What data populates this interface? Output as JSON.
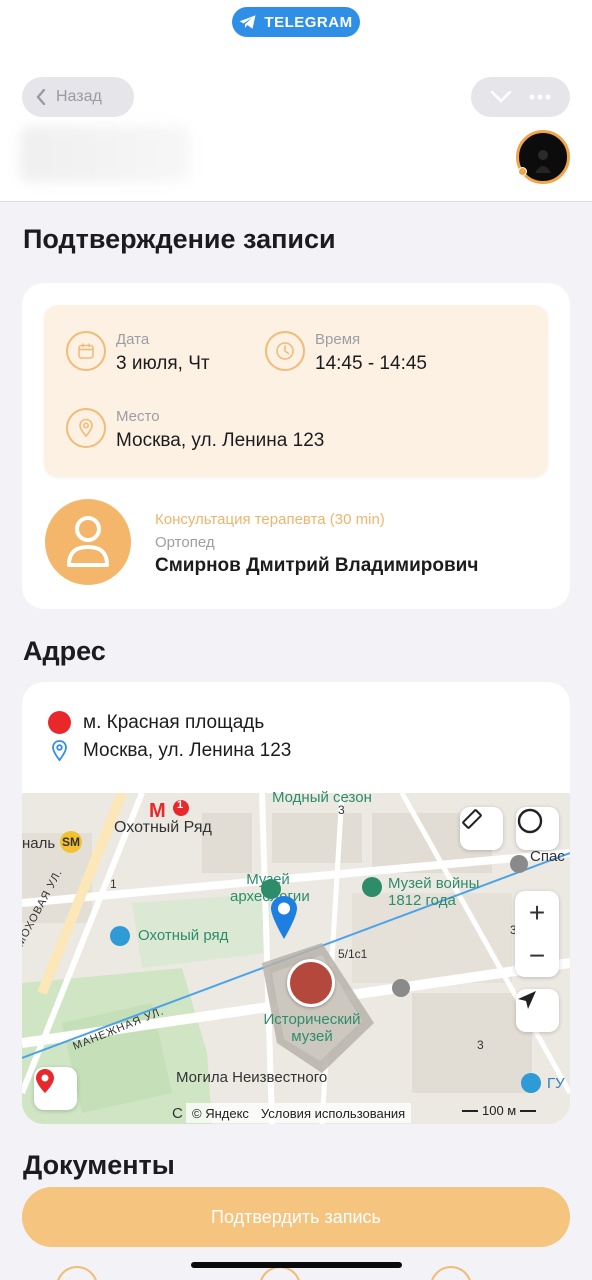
{
  "header": {
    "app_badge": "TELEGRAM",
    "back_label": "Назад"
  },
  "page_title": "Подтверждение записи",
  "appointment": {
    "date_label": "Дата",
    "date_value": "3 июля, Чт",
    "time_label": "Время",
    "time_value": "14:45 - 14:45",
    "place_label": "Место",
    "place_value": "Москва, ул. Ленина 123",
    "service": "Консультация терапевта (30 min)",
    "specialty": "Ортопед",
    "doctor": "Смирнов Дмитрий Владимирович"
  },
  "address": {
    "title": "Адрес",
    "metro": "м. Красная площадь",
    "street": "Москва, ул. Ленина 123"
  },
  "map": {
    "labels": {
      "modny_sezon": "Модный сезон",
      "okhotny_ryad_metro": "Охотный Ряд",
      "metro_line": "1",
      "museum_archaeology": "Музей археологии",
      "museum_1812": "Музей войны 1812 года",
      "okhotny_ryad_mall": "Охотный ряд",
      "historical_museum": "Исторический музей",
      "mokhovaya": "МОХОВАЯ УЛ.",
      "manezhnaya": "МАНЕЖНАЯ УЛ.",
      "tomb": "Могила Неизвестного",
      "tomb_tail": "С",
      "spas": "Спас",
      "gum": "ГУ",
      "kanal": "наль",
      "house_3a": "3",
      "house_1": "1",
      "house_5": "5/1с1",
      "house_3b": "3",
      "house_3c": "3"
    },
    "attribution": "© Яндекс",
    "terms": "Условия использования",
    "scale": "100 м"
  },
  "documents_title": "Документы",
  "confirm_button": "Подтвердить запись",
  "colors": {
    "accent": "#f3b66a",
    "telegram": "#2f8fe6",
    "metro": "#e8282b",
    "map_green": "#2e8c6b",
    "pin": "#1e7fe0"
  }
}
